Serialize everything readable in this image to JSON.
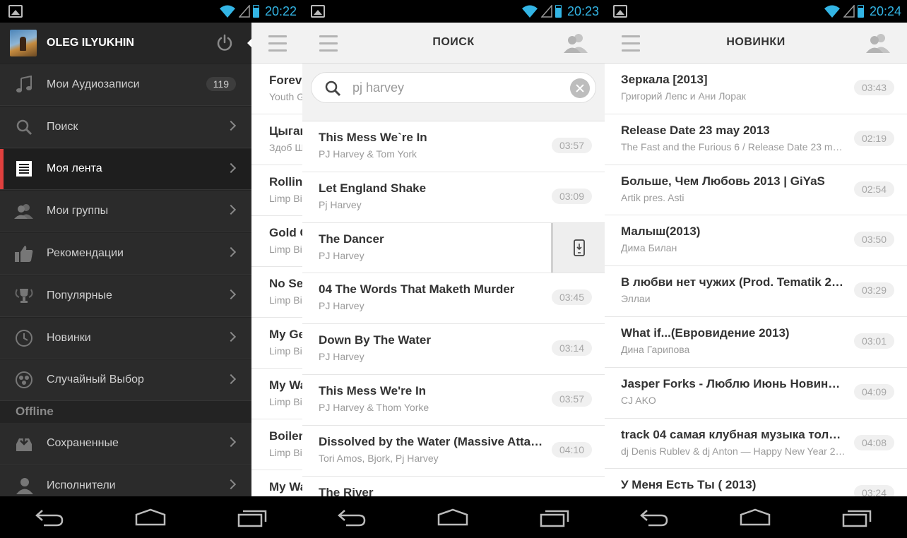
{
  "screens": [
    {
      "time": "20:22",
      "drawer": {
        "user_name": "OLEG ILYUKHIN",
        "items": [
          {
            "label": "Мои Аудиозаписи",
            "icon": "music-note-icon",
            "count": "119"
          },
          {
            "label": "Поиск",
            "icon": "search-icon"
          },
          {
            "label": "Моя лента",
            "icon": "feed-icon",
            "active": true
          },
          {
            "label": "Мои группы",
            "icon": "groups-icon"
          },
          {
            "label": "Рекомендации",
            "icon": "thumbs-up-icon"
          },
          {
            "label": "Популярные",
            "icon": "trophy-icon"
          },
          {
            "label": "Новинки",
            "icon": "clock-icon"
          },
          {
            "label": "Случайный Выбор",
            "icon": "shuffle-icon"
          }
        ],
        "offline_label": "Offline",
        "offline_items": [
          {
            "label": "Сохраненные",
            "icon": "inbox-icon"
          },
          {
            "label": "Исполнители",
            "icon": "artist-icon"
          }
        ]
      },
      "peek": [
        {
          "title": "Foreve",
          "subtitle": "Youth G"
        },
        {
          "title": "Цыган",
          "subtitle": "Здоб Ш"
        },
        {
          "title": "Rollin'",
          "subtitle": "Limp Bi"
        },
        {
          "title": "Gold C",
          "subtitle": "Limp Bi"
        },
        {
          "title": "No Se",
          "subtitle": "Limp Bi"
        },
        {
          "title": "My Ge",
          "subtitle": "Limp Bi"
        },
        {
          "title": "My Wa",
          "subtitle": "Limp Bi"
        },
        {
          "title": "Boiler",
          "subtitle": "Limp Bi"
        },
        {
          "title": "My Wa",
          "subtitle": ""
        }
      ]
    },
    {
      "time": "20:23",
      "title": "ПОИСК",
      "search": {
        "value": "pj harvey"
      },
      "tracks": [
        {
          "title": "This Mess We`re In",
          "artist": "PJ Harvey & Tom York",
          "duration": "03:57"
        },
        {
          "title": "Let England Shake",
          "artist": "Pj Harvey",
          "duration": "03:09"
        },
        {
          "title": "The Dancer",
          "artist": "PJ Harvey",
          "duration": "",
          "download": true
        },
        {
          "title": "04 The Words That Maketh Murder",
          "artist": "PJ Harvey",
          "duration": "03:45"
        },
        {
          "title": "Down By The Water",
          "artist": "PJ Harvey",
          "duration": "03:14"
        },
        {
          "title": "This Mess We're In",
          "artist": "PJ Harvey & Thom Yorke",
          "duration": "03:57"
        },
        {
          "title": "Dissolved by the Water (Massive Attack remix)",
          "artist": "Tori Amos, Bjork, Pj Harvey",
          "duration": "04:10"
        },
        {
          "title": "The River",
          "artist": "",
          "duration": ""
        }
      ]
    },
    {
      "time": "20:24",
      "title": "НОВИНКИ",
      "tracks": [
        {
          "title": "Зеркала [2013]",
          "artist": "Григорий Лепс и Ани Лорак",
          "duration": "03:43"
        },
        {
          "title": "Release Date 23 may 2013",
          "artist": "The Fast and the Furious 6 / Release Date 23 may 2013",
          "duration": "02:19"
        },
        {
          "title": "Больше, Чем Любовь 2013 | GiYaS",
          "artist": "Artik pres. Asti",
          "duration": "02:54"
        },
        {
          "title": "Малыш(2013)",
          "artist": "Дима Билан",
          "duration": "03:50"
        },
        {
          "title": "В любви нет чужих (Prod. Tematik 2013)",
          "artist": "Эллаи",
          "duration": "03:29"
        },
        {
          "title": "What if...(Евровидение 2013)",
          "artist": "Дина Гарипова",
          "duration": "03:01"
        },
        {
          "title": "Jasper Forks - Люблю Июнь Новинка 2013",
          "artist": "CJ AKO",
          "duration": "04:09"
        },
        {
          "title": "track 04 самая клубная музыка только для вас",
          "artist": "dj Denis Rublev & dj Anton — Happy New Year 2013",
          "duration": "04:08"
        },
        {
          "title": "У Меня Есть Ты ( 2013)",
          "artist": "",
          "duration": "03:24"
        }
      ]
    }
  ]
}
